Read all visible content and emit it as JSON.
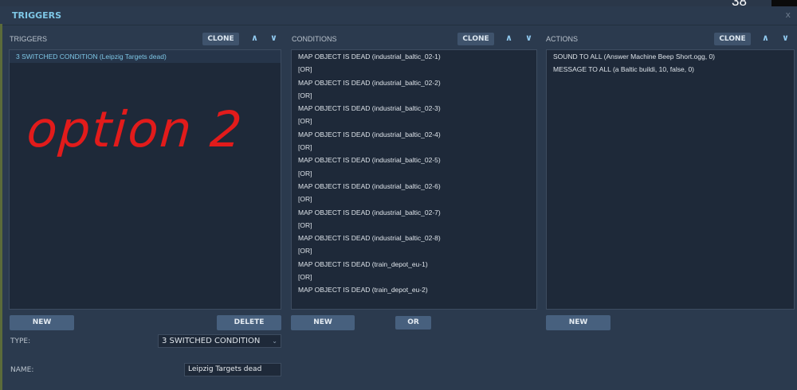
{
  "window": {
    "title": "TRIGGERS",
    "close": "x",
    "counter": "38"
  },
  "triggers": {
    "label": "TRIGGERS",
    "clone": "CLONE",
    "up": "∧",
    "down": "∨",
    "items": [
      "3 SWITCHED CONDITION (Leipzig Targets dead)"
    ],
    "new": "NEW",
    "delete": "DELETE"
  },
  "conditions": {
    "label": "CONDITIONS",
    "clone": "CLONE",
    "up": "∧",
    "down": "∨",
    "items": [
      "MAP OBJECT IS DEAD (industrial_baltic_02-1)",
      "[OR]",
      "MAP OBJECT IS DEAD (industrial_baltic_02-2)",
      "[OR]",
      "MAP OBJECT IS DEAD (industrial_baltic_02-3)",
      "[OR]",
      "MAP OBJECT IS DEAD (industrial_baltic_02-4)",
      "[OR]",
      "MAP OBJECT IS DEAD (industrial_baltic_02-5)",
      "[OR]",
      "MAP OBJECT IS DEAD (industrial_baltic_02-6)",
      "[OR]",
      "MAP OBJECT IS DEAD (industrial_baltic_02-7)",
      "[OR]",
      "MAP OBJECT IS DEAD (industrial_baltic_02-8)",
      "[OR]",
      "MAP OBJECT IS DEAD (train_depot_eu-1)",
      "[OR]",
      "MAP OBJECT IS DEAD (train_depot_eu-2)"
    ],
    "new": "NEW",
    "or": "OR"
  },
  "actions": {
    "label": "ACTIONS",
    "clone": "CLONE",
    "up": "∧",
    "down": "∨",
    "items": [
      "SOUND TO ALL (Answer Machine Beep Short.ogg, 0)",
      "MESSAGE TO ALL (a Baltic buildi, 10, false, 0)"
    ],
    "new": "NEW"
  },
  "form": {
    "type_label": "TYPE:",
    "type_value": "3 SWITCHED CONDITION",
    "name_label": "NAME:",
    "name_value": "Leipzig Targets dead"
  },
  "annotation": "option 2"
}
